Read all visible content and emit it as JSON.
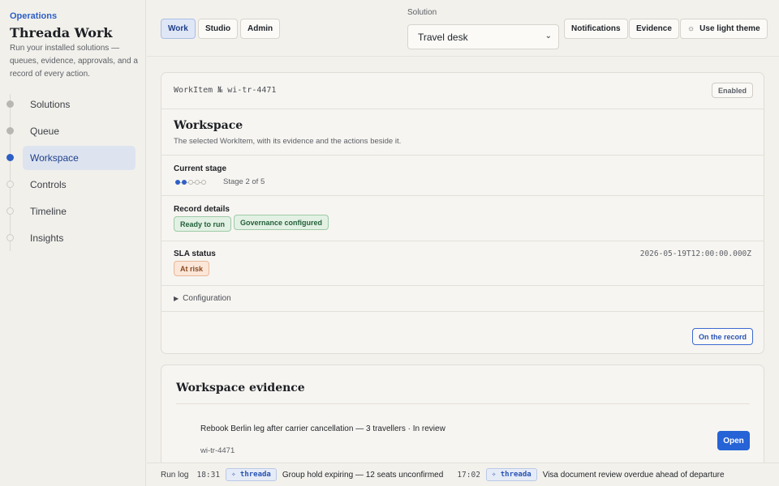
{
  "sidebar": {
    "eyebrow": "Operations",
    "title": "Threada Work",
    "description": "Run your installed solutions — queues, evidence, approvals, and a record of every action.",
    "items": [
      {
        "label": "Solutions",
        "state": "done"
      },
      {
        "label": "Queue",
        "state": "done"
      },
      {
        "label": "Workspace",
        "state": "current"
      },
      {
        "label": "Controls",
        "state": "todo"
      },
      {
        "label": "Timeline",
        "state": "todo"
      },
      {
        "label": "Insights",
        "state": "todo"
      }
    ]
  },
  "topbar": {
    "modes": [
      "Work",
      "Studio",
      "Admin"
    ],
    "active_mode": "Work",
    "solution_label": "Solution",
    "solution_value": "Travel desk",
    "notifications_label": "Notifications",
    "evidence_label": "Evidence",
    "theme_label": "Use light theme",
    "theme_icon": "sun-icon"
  },
  "workitem": {
    "id_text": "WorkItem № wi-tr-4471",
    "status_badge": "Enabled",
    "title": "Workspace",
    "subtitle": "The selected WorkItem, with its evidence and the actions beside it.",
    "stage_label": "Current stage",
    "stage_current": 2,
    "stage_total": 5,
    "stage_text": "Stage 2 of 5",
    "record_label": "Record details",
    "record_pills": [
      "Ready to run",
      "Governance configured"
    ],
    "sla_label": "SLA status",
    "sla_pill": "At risk",
    "sla_time": "2026-05-19T12:00:00.000Z",
    "config_label": "Configuration",
    "on_record_label": "On the record"
  },
  "evidence": {
    "title": "Workspace evidence",
    "item_title": "Rebook Berlin leg after carrier cancellation — 3 travellers · In review",
    "item_id": "wi-tr-4471",
    "open_label": "Open"
  },
  "runlog": {
    "label": "Run log",
    "entries": [
      {
        "time": "18:31",
        "tag": "✧ threada",
        "message": "Group hold expiring — 12 seats unconfirmed"
      },
      {
        "time": "17:02",
        "tag": "✧ threada",
        "message": "Visa document review overdue ahead of departure"
      }
    ]
  },
  "colors": {
    "accent": "#2d5fc6",
    "primary_button": "#2563d6",
    "success_bg": "#e2f1e4",
    "warning_bg": "#fbe6d8"
  }
}
